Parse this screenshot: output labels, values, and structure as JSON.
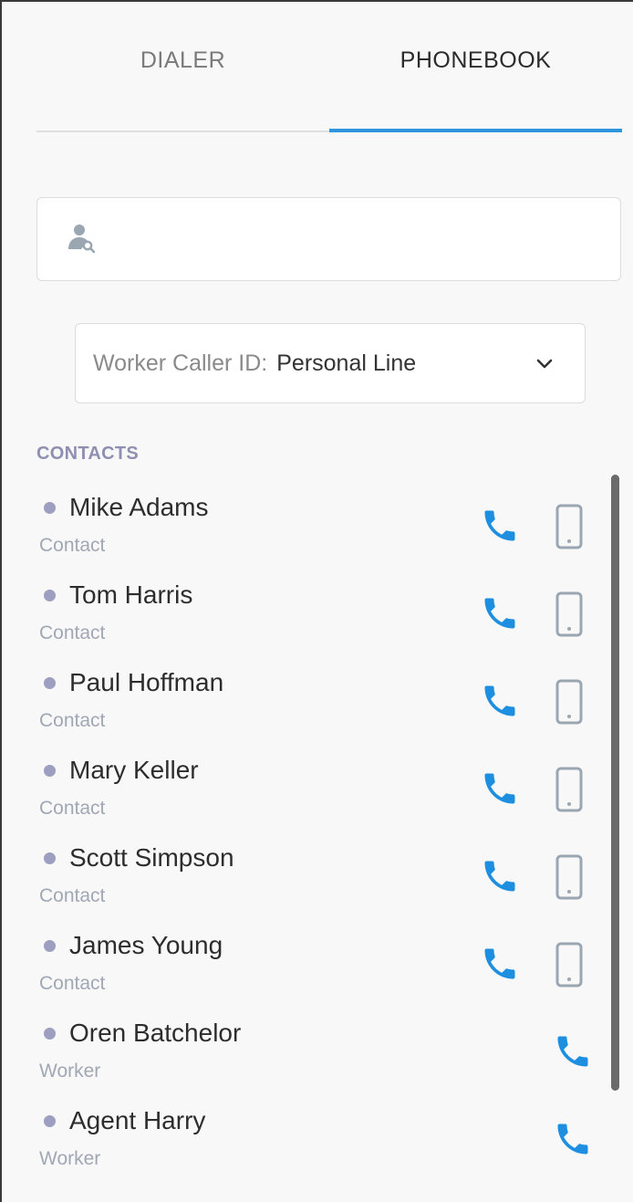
{
  "tabs": [
    {
      "label": "DIALER",
      "active": false
    },
    {
      "label": "PHONEBOOK",
      "active": true
    }
  ],
  "search": {
    "placeholder": "",
    "value": ""
  },
  "caller_id": {
    "label": "Worker Caller ID:",
    "value": "Personal Line"
  },
  "contacts": {
    "title": "CONTACTS",
    "items": [
      {
        "name": "Mike Adams",
        "type": "Contact"
      },
      {
        "name": "Tom Harris",
        "type": "Contact"
      },
      {
        "name": "Paul Hoffman",
        "type": "Contact"
      },
      {
        "name": "Mary Keller",
        "type": "Contact"
      },
      {
        "name": "Scott Simpson",
        "type": "Contact"
      },
      {
        "name": "James Young",
        "type": "Contact"
      },
      {
        "name": "Oren Batchelor",
        "type": "Worker"
      },
      {
        "name": "Agent Harry",
        "type": "Worker"
      }
    ]
  },
  "colors": {
    "accent": "#2f95de",
    "call_icon": "#1e8fe0",
    "mobile_icon": "#9aa6b2",
    "dot": "#9e9ec0",
    "section_title": "#8f8fb2"
  },
  "icons": {
    "search": "person-search-icon",
    "dropdown": "chevron-down-icon",
    "call": "phone-icon",
    "mobile": "mobile-phone-icon"
  }
}
